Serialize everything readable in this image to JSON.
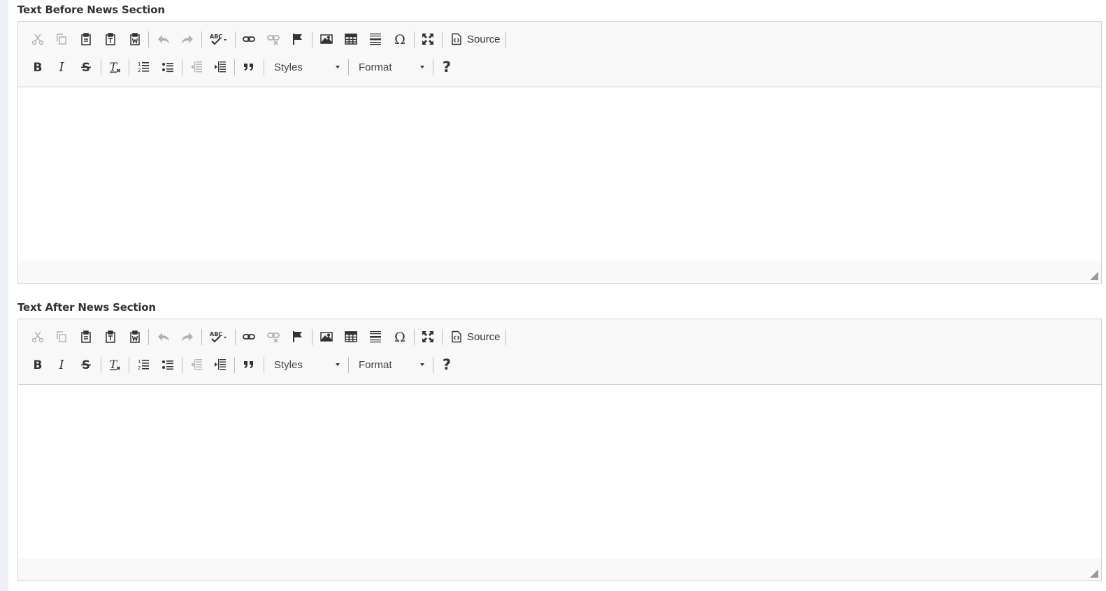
{
  "sections": [
    {
      "label": "Text Before News Section",
      "toolbar": {
        "source_label": "Source",
        "styles_label": "Styles",
        "format_label": "Format",
        "help_label": "?"
      }
    },
    {
      "label": "Text After News Section",
      "toolbar": {
        "source_label": "Source",
        "styles_label": "Styles",
        "format_label": "Format",
        "help_label": "?"
      }
    }
  ],
  "icons": {
    "row1": [
      "cut-icon",
      "copy-icon",
      "paste-icon",
      "paste-text-icon",
      "paste-word-icon",
      "undo-icon",
      "redo-icon",
      "spellcheck-icon",
      "link-icon",
      "unlink-icon",
      "anchor-icon",
      "image-icon",
      "table-icon",
      "horizontal-rule-icon",
      "special-char-icon",
      "maximize-icon",
      "source-icon"
    ],
    "row2": [
      "bold-icon",
      "italic-icon",
      "strike-icon",
      "remove-format-icon",
      "numbered-list-icon",
      "bulleted-list-icon",
      "outdent-icon",
      "indent-icon",
      "blockquote-icon",
      "styles-dropdown",
      "format-dropdown",
      "help-icon"
    ]
  },
  "colors": {
    "toolbar_bg": "#f8f8f8",
    "border": "#d1d1d1",
    "icon": "#333333",
    "label": "#333333",
    "sidebar_strip": "#edf0f5"
  }
}
